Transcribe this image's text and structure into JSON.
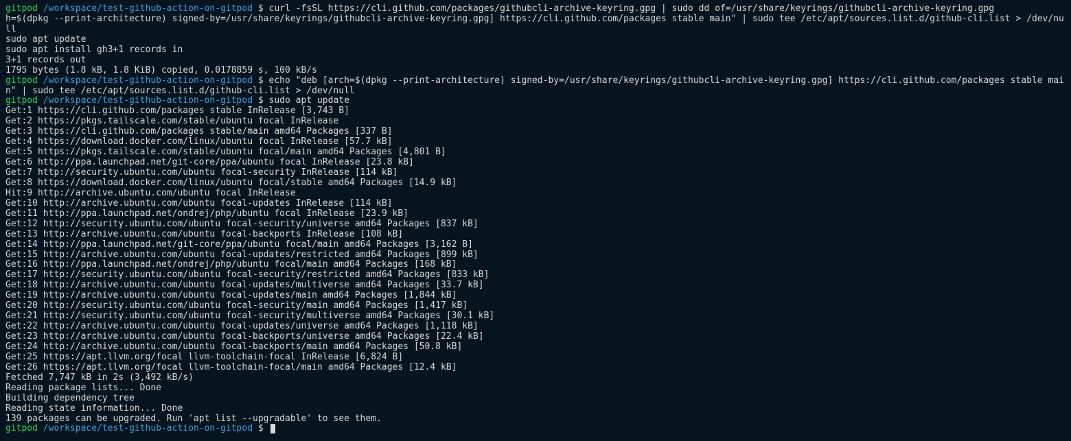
{
  "prompt": {
    "user": "gitpod",
    "path": "/workspace/test-github-action-on-gitpod",
    "sep": " $ "
  },
  "blocks": [
    {
      "kind": "prompt",
      "command": "curl -fsSL https://cli.github.com/packages/githubcli-archive-keyring.gpg | sudo dd of=/usr/share/keyrings/githubcli-archive-keyring.gpg"
    },
    {
      "kind": "out",
      "text": "h=$(dpkg --print-architecture) signed-by=/usr/share/keyrings/githubcli-archive-keyring.gpg] https://cli.github.com/packages stable main\" | sudo tee /etc/apt/sources.list.d/github-cli.list > /dev/null"
    },
    {
      "kind": "out",
      "text": "sudo apt update"
    },
    {
      "kind": "out",
      "text": "sudo apt install gh3+1 records in"
    },
    {
      "kind": "out",
      "text": "3+1 records out"
    },
    {
      "kind": "out",
      "text": "1795 bytes (1.8 kB, 1.8 KiB) copied, 0.0178859 s, 100 kB/s"
    },
    {
      "kind": "prompt",
      "command": "echo \"deb [arch=$(dpkg --print-architecture) signed-by=/usr/share/keyrings/githubcli-archive-keyring.gpg] https://cli.github.com/packages stable main\" | sudo tee /etc/apt/sources.list.d/github-cli.list > /dev/null"
    },
    {
      "kind": "prompt",
      "command": "sudo apt update"
    },
    {
      "kind": "out",
      "text": "Get:1 https://cli.github.com/packages stable InRelease [3,743 B]"
    },
    {
      "kind": "out",
      "text": "Get:2 https://pkgs.tailscale.com/stable/ubuntu focal InRelease"
    },
    {
      "kind": "out",
      "text": "Get:3 https://cli.github.com/packages stable/main amd64 Packages [337 B]"
    },
    {
      "kind": "out",
      "text": "Get:4 https://download.docker.com/linux/ubuntu focal InRelease [57.7 kB]"
    },
    {
      "kind": "out",
      "text": "Get:5 https://pkgs.tailscale.com/stable/ubuntu focal/main amd64 Packages [4,801 B]"
    },
    {
      "kind": "out",
      "text": "Get:6 http://ppa.launchpad.net/git-core/ppa/ubuntu focal InRelease [23.8 kB]"
    },
    {
      "kind": "out",
      "text": "Get:7 http://security.ubuntu.com/ubuntu focal-security InRelease [114 kB]"
    },
    {
      "kind": "out",
      "text": "Get:8 https://download.docker.com/linux/ubuntu focal/stable amd64 Packages [14.9 kB]"
    },
    {
      "kind": "out",
      "text": "Hit:9 http://archive.ubuntu.com/ubuntu focal InRelease"
    },
    {
      "kind": "out",
      "text": "Get:10 http://archive.ubuntu.com/ubuntu focal-updates InRelease [114 kB]"
    },
    {
      "kind": "out",
      "text": "Get:11 http://ppa.launchpad.net/ondrej/php/ubuntu focal InRelease [23.9 kB]"
    },
    {
      "kind": "out",
      "text": "Get:12 http://security.ubuntu.com/ubuntu focal-security/universe amd64 Packages [837 kB]"
    },
    {
      "kind": "out",
      "text": "Get:13 http://archive.ubuntu.com/ubuntu focal-backports InRelease [108 kB]"
    },
    {
      "kind": "out",
      "text": "Get:14 http://ppa.launchpad.net/git-core/ppa/ubuntu focal/main amd64 Packages [3,162 B]"
    },
    {
      "kind": "out",
      "text": "Get:15 http://archive.ubuntu.com/ubuntu focal-updates/restricted amd64 Packages [899 kB]"
    },
    {
      "kind": "out",
      "text": "Get:16 http://ppa.launchpad.net/ondrej/php/ubuntu focal/main amd64 Packages [168 kB]"
    },
    {
      "kind": "out",
      "text": "Get:17 http://security.ubuntu.com/ubuntu focal-security/restricted amd64 Packages [833 kB]"
    },
    {
      "kind": "out",
      "text": "Get:18 http://archive.ubuntu.com/ubuntu focal-updates/multiverse amd64 Packages [33.7 kB]"
    },
    {
      "kind": "out",
      "text": "Get:19 http://archive.ubuntu.com/ubuntu focal-updates/main amd64 Packages [1,844 kB]"
    },
    {
      "kind": "out",
      "text": "Get:20 http://security.ubuntu.com/ubuntu focal-security/main amd64 Packages [1,417 kB]"
    },
    {
      "kind": "out",
      "text": "Get:21 http://security.ubuntu.com/ubuntu focal-security/multiverse amd64 Packages [30.1 kB]"
    },
    {
      "kind": "out",
      "text": "Get:22 http://archive.ubuntu.com/ubuntu focal-updates/universe amd64 Packages [1,118 kB]"
    },
    {
      "kind": "out",
      "text": "Get:23 http://archive.ubuntu.com/ubuntu focal-backports/universe amd64 Packages [22.4 kB]"
    },
    {
      "kind": "out",
      "text": "Get:24 http://archive.ubuntu.com/ubuntu focal-backports/main amd64 Packages [50.8 kB]"
    },
    {
      "kind": "out",
      "text": "Get:25 https://apt.llvm.org/focal llvm-toolchain-focal InRelease [6,824 B]"
    },
    {
      "kind": "out",
      "text": "Get:26 https://apt.llvm.org/focal llvm-toolchain-focal/main amd64 Packages [12.4 kB]"
    },
    {
      "kind": "out",
      "text": "Fetched 7,747 kB in 2s (3,492 kB/s)"
    },
    {
      "kind": "out",
      "text": "Reading package lists... Done"
    },
    {
      "kind": "out",
      "text": "Building dependency tree"
    },
    {
      "kind": "out",
      "text": "Reading state information... Done"
    },
    {
      "kind": "out",
      "text": "139 packages can be upgraded. Run 'apt list --upgradable' to see them."
    },
    {
      "kind": "prompt",
      "command": "",
      "cursor": true
    }
  ]
}
